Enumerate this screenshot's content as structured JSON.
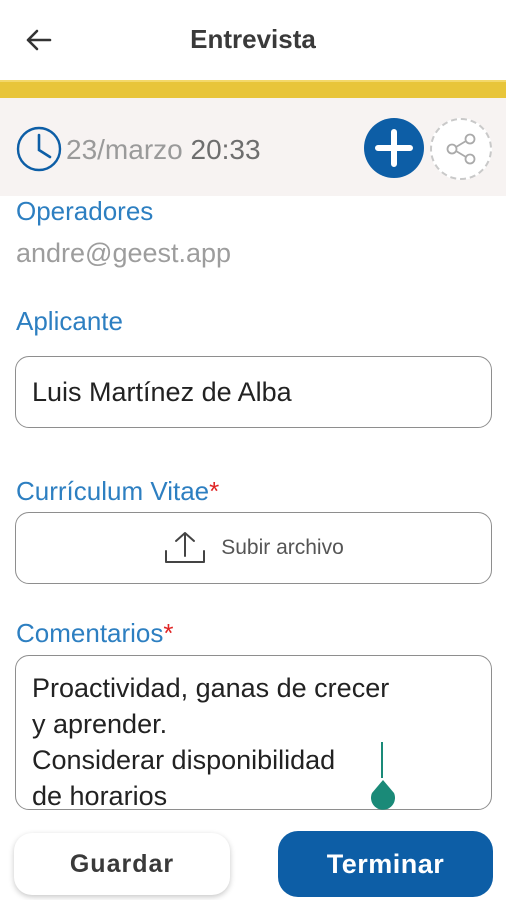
{
  "header": {
    "title": "Entrevista"
  },
  "icons": {
    "back": "arrow-left-icon",
    "clock": "clock-icon",
    "add": "plus-circle-icon",
    "share": "share-icon",
    "upload": "upload-icon"
  },
  "datetime": {
    "date": "23/marzo",
    "time": "20:33"
  },
  "operators": {
    "label": "Operadores",
    "value": "andre@geest.app"
  },
  "applicant": {
    "label": "Aplicante",
    "value": "Luis Martínez de Alba"
  },
  "cv": {
    "label": "Currículum Vitae",
    "required_mark": "*",
    "button_label": "Subir archivo"
  },
  "comments": {
    "label": "Comentarios",
    "required_mark": "*",
    "value": "Proactividad, ganas de crecer\ny aprender.\nConsiderar disponibilidad\nde horarios"
  },
  "actions": {
    "save_label": "Guardar",
    "finish_label": "Terminar"
  },
  "colors": {
    "accent_blue": "#0d5ea6",
    "label_blue": "#2d7fc1",
    "yellow_band": "#e8c53a",
    "required_red": "#e02424",
    "caret_teal": "#1a8a78"
  }
}
